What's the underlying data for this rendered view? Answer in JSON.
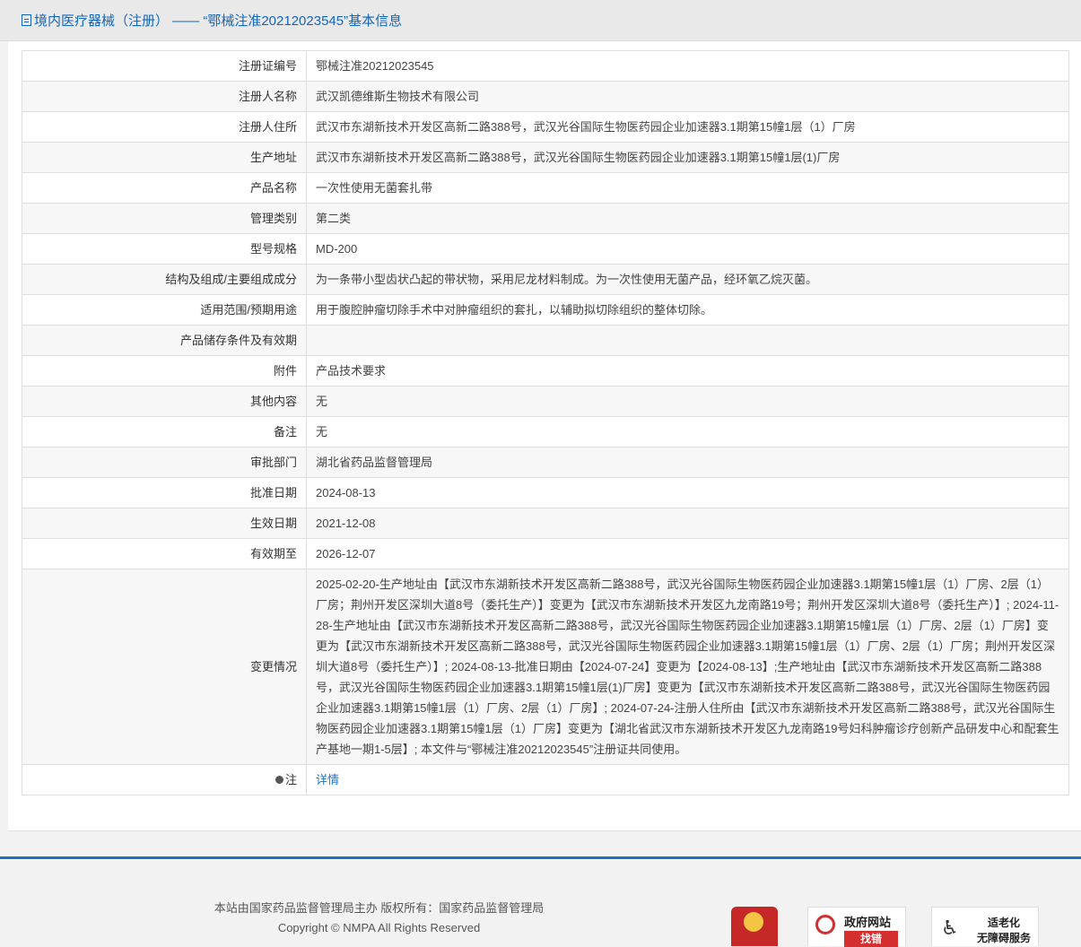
{
  "title": "境内医疗器械（注册） ——  “鄂械注准20212023545”基本信息",
  "rows": [
    {
      "label": "注册证编号",
      "value": "鄂械注准20212023545"
    },
    {
      "label": "注册人名称",
      "value": "武汉凯德维斯生物技术有限公司"
    },
    {
      "label": "注册人住所",
      "value": "武汉市东湖新技术开发区高新二路388号，武汉光谷国际生物医药园企业加速器3.1期第15幢1层（1）厂房"
    },
    {
      "label": "生产地址",
      "value": "武汉市东湖新技术开发区高新二路388号，武汉光谷国际生物医药园企业加速器3.1期第15幢1层(1)厂房"
    },
    {
      "label": "产品名称",
      "value": "一次性使用无菌套扎带"
    },
    {
      "label": "管理类别",
      "value": "第二类"
    },
    {
      "label": "型号规格",
      "value": "MD-200"
    },
    {
      "label": "结构及组成/主要组成成分",
      "value": "为一条带小型齿状凸起的带状物，采用尼龙材料制成。为一次性使用无菌产品，经环氧乙烷灭菌。"
    },
    {
      "label": "适用范围/预期用途",
      "value": "用于腹腔肿瘤切除手术中对肿瘤组织的套扎，以辅助拟切除组织的整体切除。"
    },
    {
      "label": "产品储存条件及有效期",
      "value": ""
    },
    {
      "label": "附件",
      "value": "产品技术要求"
    },
    {
      "label": "其他内容",
      "value": "无"
    },
    {
      "label": "备注",
      "value": "无"
    },
    {
      "label": "审批部门",
      "value": "湖北省药品监督管理局"
    },
    {
      "label": "批准日期",
      "value": "2024-08-13"
    },
    {
      "label": "生效日期",
      "value": "2021-12-08"
    },
    {
      "label": "有效期至",
      "value": "2026-12-07"
    }
  ],
  "changes": {
    "label": "变更情况",
    "value": "2025-02-20-生产地址由【武汉市东湖新技术开发区高新二路388号，武汉光谷国际生物医药园企业加速器3.1期第15幢1层（1）厂房、2层（1）厂房；荆州开发区深圳大道8号（委托生产）】变更为【武汉市东湖新技术开发区九龙南路19号；荆州开发区深圳大道8号（委托生产）】; 2024-11-28-生产地址由【武汉市东湖新技术开发区高新二路388号，武汉光谷国际生物医药园企业加速器3.1期第15幢1层（1）厂房、2层（1）厂房】变更为【武汉市东湖新技术开发区高新二路388号，武汉光谷国际生物医药园企业加速器3.1期第15幢1层（1）厂房、2层（1）厂房；荆州开发区深圳大道8号（委托生产）】; 2024-08-13-批准日期由【2024-07-24】变更为【2024-08-13】;生产地址由【武汉市东湖新技术开发区高新二路388号，武汉光谷国际生物医药园企业加速器3.1期第15幢1层(1)厂房】变更为【武汉市东湖新技术开发区高新二路388号，武汉光谷国际生物医药园企业加速器3.1期第15幢1层（1）厂房、2层（1）厂房】; 2024-07-24-注册人住所由【武汉市东湖新技术开发区高新二路388号，武汉光谷国际生物医药园企业加速器3.1期第15幢1层（1）厂房】变更为【湖北省武汉市东湖新技术开发区九龙南路19号妇科肿瘤诊疗创新产品研发中心和配套生产基地一期1-5层】; 本文件与“鄂械注准20212023545”注册证共同使用。"
  },
  "note": {
    "label": "注",
    "link_text": "详情"
  },
  "footer": {
    "line1": "本站由国家药品监督管理局主办 版权所有：国家药品监督管理局",
    "line2": "Copyright © NMPA All Rights Reserved",
    "gov_badge_top": "政府网站",
    "gov_badge_bottom": "找错",
    "acc_badge_top": "适老化",
    "acc_badge_bottom": "无障碍服务"
  }
}
